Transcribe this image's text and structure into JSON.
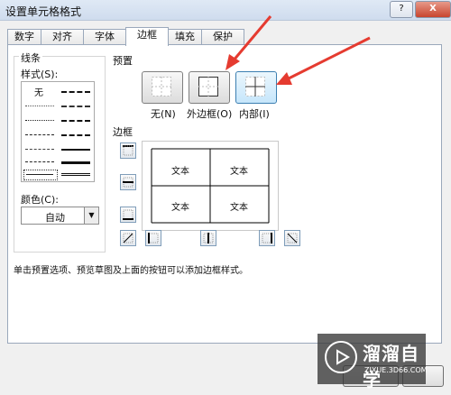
{
  "window": {
    "title": "设置单元格格式",
    "help_label": "?",
    "close_label": "X"
  },
  "tabs": [
    "数字",
    "对齐",
    "字体",
    "边框",
    "填充",
    "保护"
  ],
  "active_tab": "边框",
  "line_section": {
    "title": "线条",
    "style_label": "样式(S):",
    "none_label": "无",
    "color_label": "颜色(C):",
    "color_value": "自动"
  },
  "preset_section": {
    "title": "预置",
    "buttons": [
      "无(N)",
      "外边框(O)",
      "内部(I)"
    ]
  },
  "border_section": {
    "title": "边框",
    "cells": [
      "文本",
      "文本",
      "文本",
      "文本"
    ]
  },
  "hint_text": "单击预置选项、预览草图及上面的按钮可以添加边框样式。",
  "watermark": {
    "main": "溜溜自学",
    "sub": "ZIXUE.3D66.COM"
  },
  "colors": {
    "accent_arrow": "#e53b30",
    "highlight": "#c6e6fb"
  }
}
